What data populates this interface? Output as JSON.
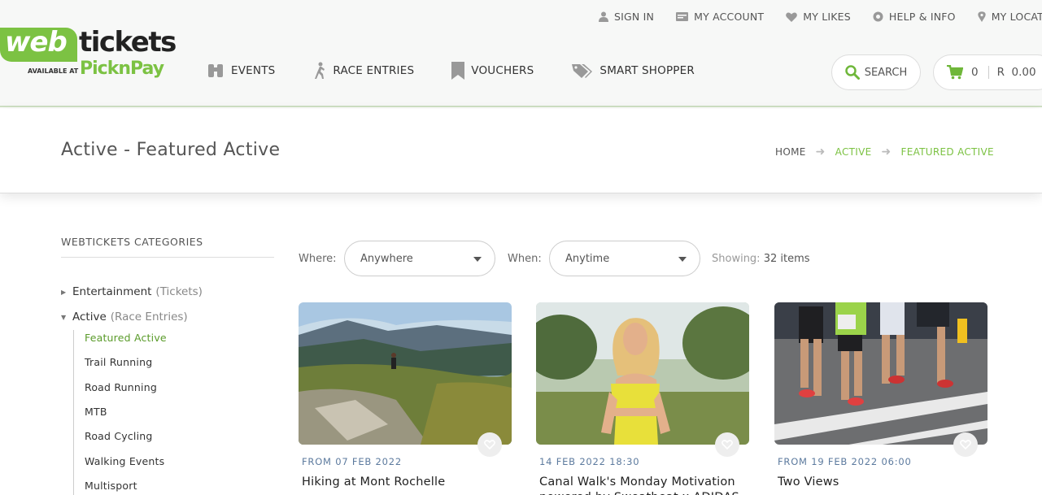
{
  "topbar": {
    "sign_in": "SIGN IN",
    "my_account": "MY ACCOUNT",
    "my_likes": "MY LIKES",
    "help_info": "HELP & INFO",
    "my_location": "MY LOCATION"
  },
  "logo": {
    "web": "web",
    "tickets": "tickets",
    "available_at": "AVAILABLE AT",
    "partner": "PicknPay"
  },
  "nav": {
    "events": "EVENTS",
    "race_entries": "RACE ENTRIES",
    "vouchers": "VOUCHERS",
    "smart_shopper": "SMART SHOPPER"
  },
  "search": {
    "label": "SEARCH"
  },
  "cart": {
    "count": "0",
    "total": "R  0.00"
  },
  "page": {
    "title": "Active - Featured Active"
  },
  "breadcrumb": {
    "home": "HOME",
    "active": "ACTIVE",
    "current": "FEATURED ACTIVE"
  },
  "sidebar": {
    "title": "WEBTICKETS CATEGORIES",
    "categories": [
      {
        "label": "Entertainment",
        "sub": "(Tickets)"
      },
      {
        "label": "Active",
        "sub": "(Race Entries)"
      }
    ],
    "subitems": [
      "Featured Active",
      "Trail Running",
      "Road Running",
      "MTB",
      "Road Cycling",
      "Walking Events",
      "Multisport"
    ]
  },
  "filters": {
    "where_label": "Where:",
    "where_value": "Anywhere",
    "when_label": "When:",
    "when_value": "Anytime",
    "showing_label": "Showing:",
    "showing_count": "32 items"
  },
  "cards": [
    {
      "date": "FROM 07 FEB 2022",
      "title": "Hiking at Mont Rochelle"
    },
    {
      "date": "14 FEB 2022 18:30",
      "title": "Canal Walk's Monday Motivation powered by Sweatbeat x ADIDAS"
    },
    {
      "date": "FROM 19 FEB 2022 06:00",
      "title": "Two Views"
    }
  ],
  "colors": {
    "brand_green": "#7cc243",
    "date_blue": "#5c7a9e"
  }
}
